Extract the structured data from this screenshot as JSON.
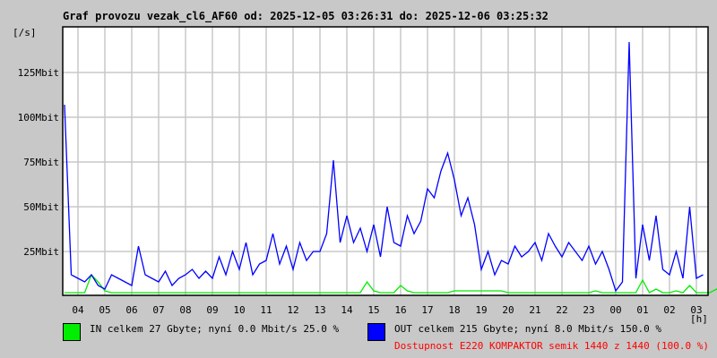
{
  "chart_data": {
    "type": "line",
    "title": "Graf provozu vezak_cl6_AF60 od: 2025-12-05 03:26:31 do: 2025-12-06 03:25:32",
    "ylabel": "[/s]",
    "xlabel": "[h]",
    "ylim": [
      0,
      150
    ],
    "yticks": [
      {
        "value": 25,
        "label": "25Mbit"
      },
      {
        "value": 50,
        "label": "50Mbit"
      },
      {
        "value": 75,
        "label": "75Mbit"
      },
      {
        "value": 100,
        "label": "100Mbit"
      },
      {
        "value": 125,
        "label": "125Mbit"
      }
    ],
    "xticks": [
      "04",
      "05",
      "06",
      "07",
      "08",
      "09",
      "10",
      "11",
      "12",
      "13",
      "14",
      "15",
      "16",
      "17",
      "18",
      "19",
      "20",
      "21",
      "22",
      "23",
      "00",
      "01",
      "02",
      "03"
    ],
    "x_start_hour": 3.5,
    "x_step_hours": 0.25,
    "grid": true,
    "series": [
      {
        "name": "IN",
        "color": "#00ee00",
        "values": [
          2,
          2,
          2,
          2,
          12,
          8,
          3,
          2,
          2,
          2,
          2,
          2,
          2,
          2,
          2,
          2,
          2,
          2,
          2,
          2,
          2,
          2,
          2,
          2,
          2,
          2,
          2,
          2,
          2,
          2,
          2,
          2,
          2,
          2,
          2,
          2,
          2,
          2,
          2,
          2,
          2,
          2,
          2,
          2,
          2,
          8,
          3,
          2,
          2,
          2,
          6,
          3,
          2,
          2,
          2,
          2,
          2,
          2,
          3,
          3,
          3,
          3,
          3,
          3,
          3,
          3,
          2,
          2,
          2,
          2,
          2,
          2,
          2,
          2,
          2,
          2,
          2,
          2,
          2,
          3,
          2,
          2,
          2,
          2,
          2,
          2,
          9,
          2,
          4,
          2,
          2,
          3,
          2,
          6,
          2,
          2,
          2,
          4,
          2,
          2
        ]
      },
      {
        "name": "OUT",
        "color": "#0000ff",
        "values": [
          107,
          12,
          10,
          8,
          12,
          6,
          4,
          12,
          10,
          8,
          6,
          28,
          12,
          10,
          8,
          14,
          6,
          10,
          12,
          15,
          10,
          14,
          10,
          22,
          12,
          25,
          15,
          30,
          12,
          18,
          20,
          35,
          18,
          28,
          15,
          30,
          20,
          25,
          25,
          35,
          76,
          30,
          45,
          30,
          38,
          25,
          40,
          22,
          50,
          30,
          28,
          45,
          35,
          42,
          60,
          55,
          70,
          80,
          65,
          45,
          55,
          40,
          15,
          25,
          12,
          20,
          18,
          28,
          22,
          25,
          30,
          20,
          35,
          28,
          22,
          30,
          25,
          20,
          28,
          18,
          25,
          15,
          3,
          8,
          142,
          10,
          40,
          20,
          45,
          15,
          12,
          25,
          10,
          50,
          10,
          12
        ]
      }
    ]
  },
  "legend": {
    "in_text": "IN celkem 27 Gbyte; nyní   0.0 Mbit/s 25.0 %",
    "out_text": "OUT celkem 215 Gbyte; nyní   8.0 Mbit/s 150.0 %",
    "availability": "Dostupnost E220 KOMPAKTOR semik 1440 z 1440 (100.0 %)"
  }
}
